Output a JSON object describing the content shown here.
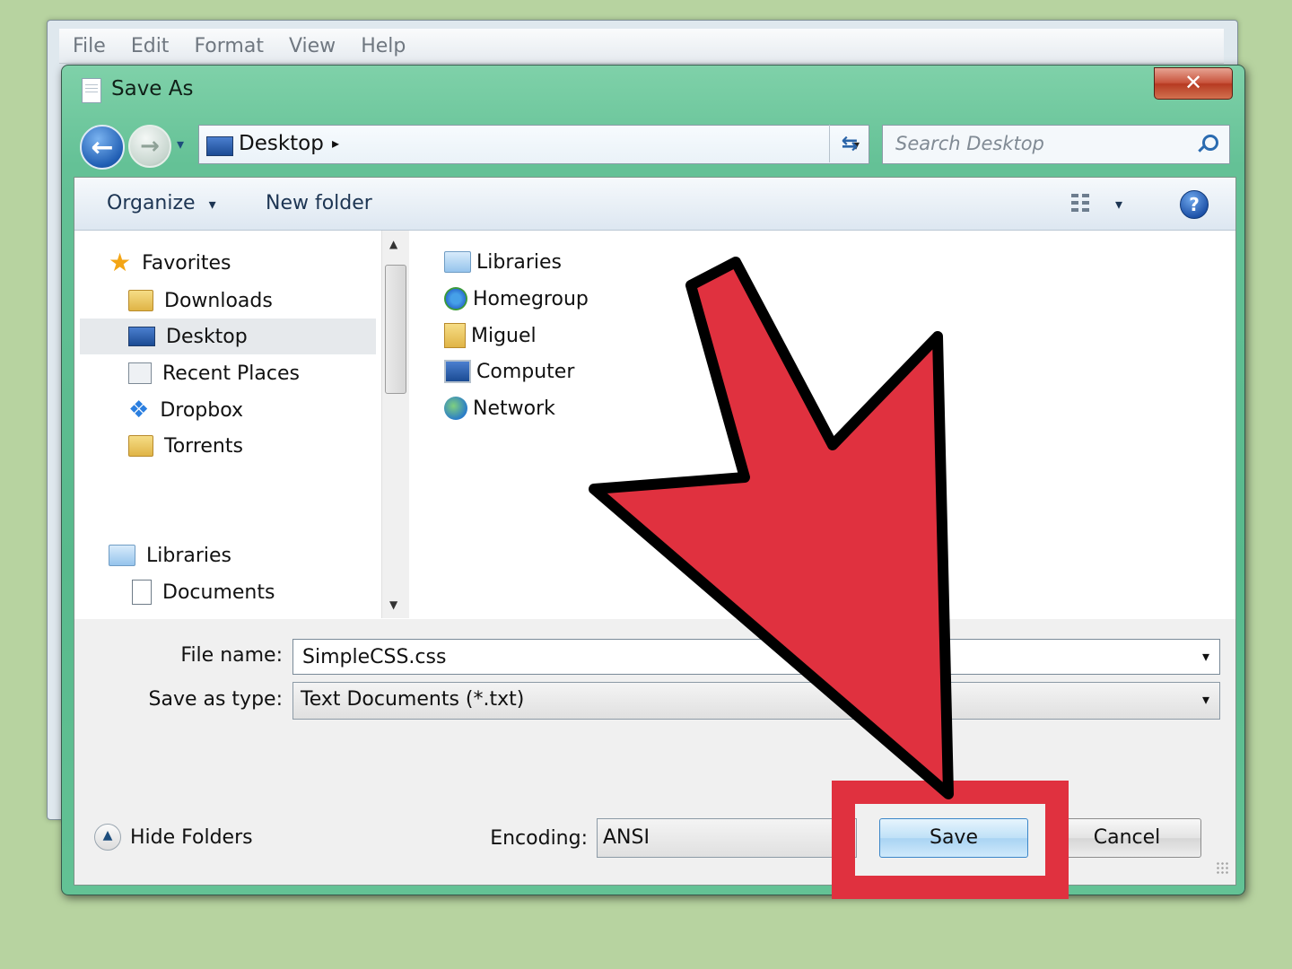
{
  "background_window": {
    "menu": [
      "File",
      "Edit",
      "Format",
      "View",
      "Help"
    ]
  },
  "dialog": {
    "title": "Save As",
    "close_glyph": "✕",
    "back_glyph": "←",
    "forward_glyph": "→",
    "history_glyph": "▾",
    "address": {
      "location": "Desktop",
      "chevron": "▸",
      "dropdown_glyph": "▾",
      "refresh_glyph": "⇆"
    },
    "search": {
      "placeholder": "Search Desktop"
    },
    "toolbar": {
      "organize_label": "Organize",
      "organize_glyph": "▾",
      "new_folder_label": "New folder",
      "views_glyph": "▾",
      "help_glyph": "?"
    },
    "nav_pane": {
      "items": [
        {
          "label": "Favorites",
          "icon": "star-icon"
        },
        {
          "label": "Downloads",
          "icon": "downloads-folder-icon"
        },
        {
          "label": "Desktop",
          "icon": "desktop-icon",
          "selected": true
        },
        {
          "label": "Recent Places",
          "icon": "recent-places-icon"
        },
        {
          "label": "Dropbox",
          "icon": "dropbox-icon"
        },
        {
          "label": "Torrents",
          "icon": "folder-icon"
        },
        {
          "label": "Libraries",
          "icon": "libraries-icon"
        },
        {
          "label": "Documents",
          "icon": "document-icon"
        }
      ],
      "scroll_up_glyph": "▲",
      "scroll_down_glyph": "▼"
    },
    "files": [
      {
        "label": "Libraries",
        "icon": "libraries-icon"
      },
      {
        "label": "Homegroup",
        "icon": "homegroup-icon"
      },
      {
        "label": "Miguel",
        "icon": "user-folder-icon"
      },
      {
        "label": "Computer",
        "icon": "computer-icon"
      },
      {
        "label": "Network",
        "icon": "network-icon"
      }
    ],
    "file_name": {
      "label": "File name:",
      "value": "SimpleCSS.css",
      "dropdown_glyph": "▾"
    },
    "save_as_type": {
      "label": "Save as type:",
      "value": "Text Documents (*.txt)",
      "dropdown_glyph": "▾"
    },
    "hide_folders": {
      "label": "Hide Folders",
      "glyph": "▲"
    },
    "encoding": {
      "label": "Encoding:",
      "value": "ANSI"
    },
    "buttons": {
      "save": "Save",
      "cancel": "Cancel"
    }
  },
  "annotation": {
    "color": "#e0313f",
    "outline": "#000000"
  }
}
